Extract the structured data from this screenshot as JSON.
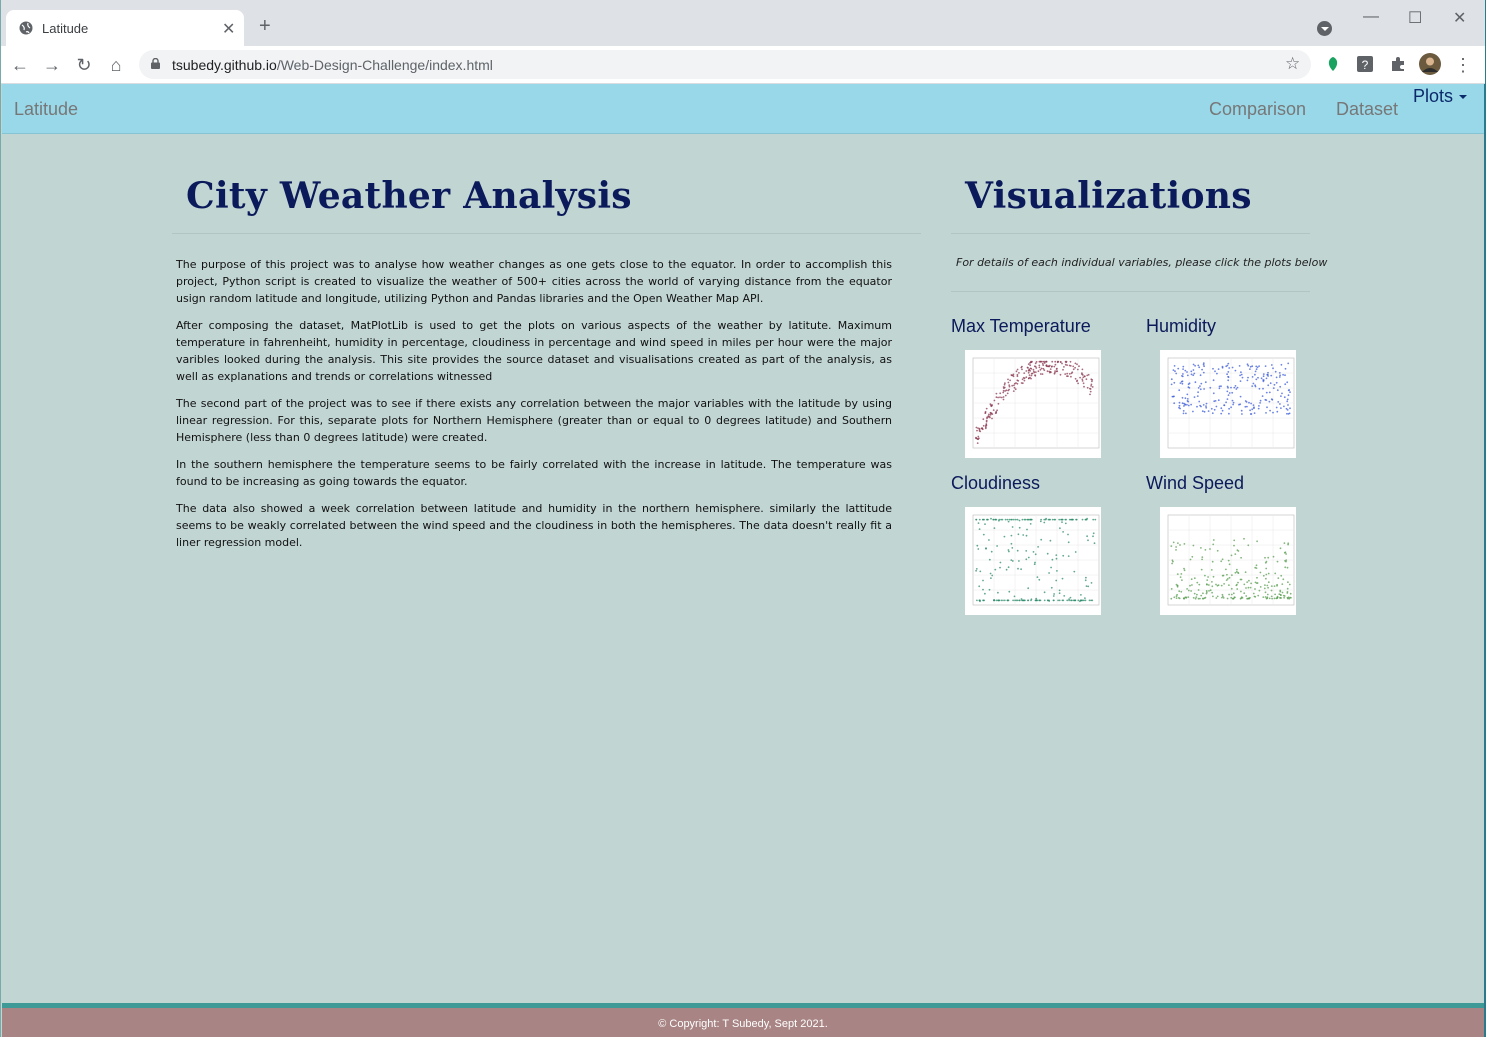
{
  "browser": {
    "tab_title": "Latitude",
    "url_host": "tsubedy.github.io",
    "url_path": "/Web-Design-Challenge/index.html"
  },
  "navbar": {
    "brand": "Latitude",
    "links": [
      "Comparison",
      "Dataset"
    ],
    "dropdown": "Plots"
  },
  "main": {
    "title": "City Weather Analysis",
    "paragraphs": [
      "The purpose of this project was to analyse how weather changes as one gets close to the equator. In order to accomplish this project, Python script is created to visualize the weather of 500+ cities across the world of varying distance from the equator usign random latitude and longitude, utilizing Python and Pandas libraries and the Open Weather Map API.",
      "After composing the dataset, MatPlotLib is used to get the plots on various aspects of the weather by latitute. Maximum temperature in fahrenheiht, humidity in percentage, cloudiness in percentage and wind speed in miles per hour were the major varibles looked during the analysis. This site provides the source dataset and visualisations created as part of the analysis, as well as explanations and trends or correlations witnessed",
      "The second part of the project was to see if there exists any correlation between the major variables with the latitude by using linear regression. For this, separate plots for Northern Hemisphere (greater than or equal to 0 degrees latitude) and Southern Hemisphere (less than 0 degrees latitude) were created.",
      "In the southern hemisphere the temperature seems to be fairly correlated with the increase in latitude. The temperature was found to be increasing as going towards the equator.",
      "The data also showed a week correlation between latitude and humidity in the northern hemisphere. similarly the lattitude seems to be weakly correlated between the wind speed and the cloudiness in both the hemispheres. The data doesn't really fit a liner regression model."
    ]
  },
  "sidebar": {
    "title": "Visualizations",
    "note": "For details of each individual variables, please click the plots below",
    "plots": [
      {
        "label": "Max Temperature",
        "color": "#8b3a52"
      },
      {
        "label": "Humidity",
        "color": "#3b5bd9"
      },
      {
        "label": "Cloudiness",
        "color": "#2e8b6a"
      },
      {
        "label": "Wind Speed",
        "color": "#5a9e52"
      }
    ]
  },
  "footer": {
    "text": "© Copyright: T Subedy, Sept 2021."
  }
}
